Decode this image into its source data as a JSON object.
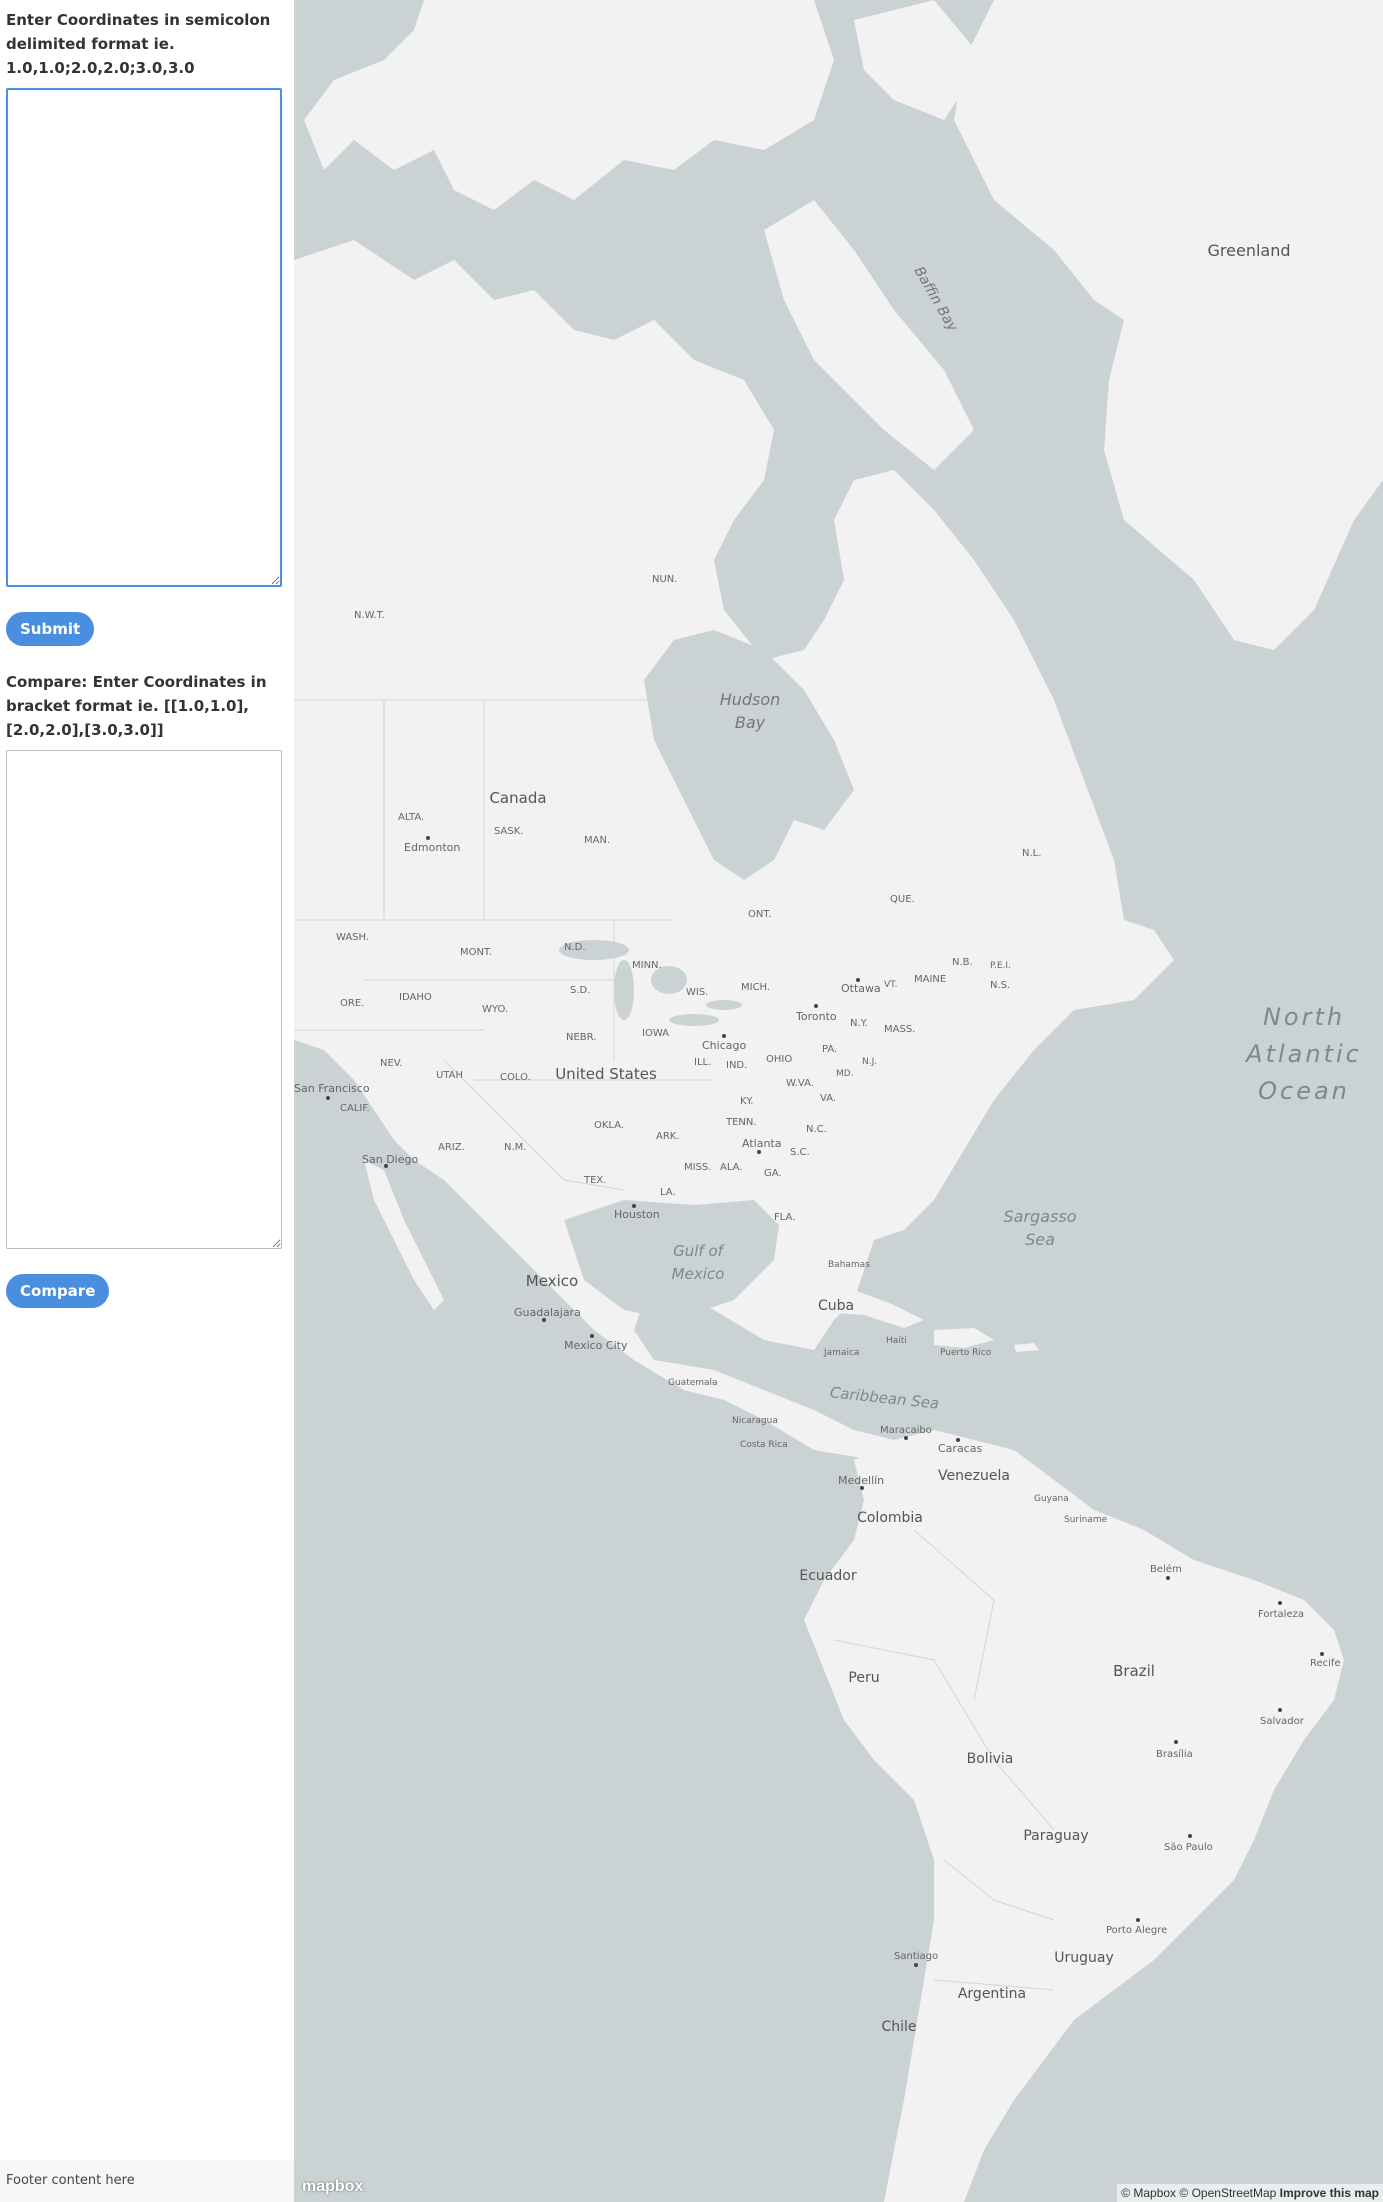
{
  "sidebar": {
    "input_label": "Enter Coordinates in semicolon delimited format ie. 1.0,1.0;2.0,2.0;3.0,3.0",
    "input_value": "",
    "submit_label": "Submit",
    "compare_label_text": "Compare: Enter Coordinates in bracket format ie. [[1.0,1.0],[2.0,2.0],[3.0,3.0]]",
    "compare_value": "",
    "compare_button_label": "Compare",
    "footer_text": "Footer content here"
  },
  "map": {
    "land_color": "#f2f2f2",
    "water_color": "#cad2d3",
    "labels": {
      "greenland": "Greenland",
      "baffin_bay": "Baffin Bay",
      "hudson_bay": "Hudson Bay",
      "canada": "Canada",
      "nwt": "N.W.T.",
      "nun": "NUN.",
      "alta": "ALTA.",
      "sask": "SASK.",
      "man": "MAN.",
      "edmonton": "Edmonton",
      "ont": "ONT.",
      "que": "QUE.",
      "nl": "N.L.",
      "nb": "N.B.",
      "ns": "N.S.",
      "pei": "P.E.I.",
      "ottawa": "Ottawa",
      "toronto": "Toronto",
      "wash": "WASH.",
      "mont": "MONT.",
      "nd": "N.D.",
      "minn": "MINN.",
      "ore": "ORE.",
      "idaho": "IDAHO",
      "wyo": "WYO.",
      "sd": "S.D.",
      "wis": "WIS.",
      "mich": "MICH.",
      "ny": "N.Y.",
      "vt": "VT.",
      "maine": "MAINE",
      "mass": "MASS.",
      "nebr": "NEBR.",
      "iowa": "IOWA",
      "nev": "NEV.",
      "utah": "UTAH",
      "colo": "COLO.",
      "ill": "ILL.",
      "ind": "IND.",
      "ohio": "OHIO",
      "pa": "PA.",
      "md": "MD.",
      "nj": "N.J.",
      "chicago": "Chicago",
      "united_states": "United States",
      "wva": "W.VA.",
      "va": "VA.",
      "ky": "KY.",
      "calif": "CALIF.",
      "san_francisco": "San Francisco",
      "ariz": "ARIZ.",
      "nm": "N.M.",
      "okla": "OKLA.",
      "ark": "ARK.",
      "tenn": "TENN.",
      "nc": "N.C.",
      "sc": "S.C.",
      "atlanta": "Atlanta",
      "san_diego": "San Diego",
      "tex": "TEX.",
      "miss": "MISS.",
      "ala": "ALA.",
      "ga": "GA.",
      "la": "LA.",
      "fla": "FLA.",
      "houston": "Houston",
      "north_atlantic_1": "North",
      "north_atlantic_2": "Atlantic",
      "north_atlantic_3": "Ocean",
      "sargasso_1": "Sargasso",
      "sargasso_2": "Sea",
      "gulf_1": "Gulf of",
      "gulf_2": "Mexico",
      "mexico": "Mexico",
      "bahamas": "Bahamas",
      "cuba": "Cuba",
      "guadalajara": "Guadalajara",
      "mexico_city": "Mexico City",
      "haiti": "Haiti",
      "jamaica": "Jamaica",
      "puerto_rico": "Puerto Rico",
      "guatemala": "Guatemala",
      "caribbean": "Caribbean Sea",
      "nicaragua": "Nicaragua",
      "maracaibo": "Maracaibo",
      "caracas": "Caracas",
      "costa_rica": "Costa Rica",
      "venezuela": "Venezuela",
      "medellin": "Medellín",
      "guyana": "Guyana",
      "suriname": "Suriname",
      "colombia": "Colombia",
      "belem": "Belém",
      "ecuador": "Ecuador",
      "fortaleza": "Fortaleza",
      "recife": "Recife",
      "peru": "Peru",
      "brazil": "Brazil",
      "salvador": "Salvador",
      "bolivia": "Bolivia",
      "brasilia": "Brasília",
      "paraguay": "Paraguay",
      "sao_paulo": "São Paulo",
      "porto_alegre": "Porto Alegre",
      "santiago": "Santiago",
      "uruguay": "Uruguay",
      "argentina": "Argentina",
      "chile": "Chile"
    },
    "attribution": {
      "mapbox": "© Mapbox",
      "osm": "© OpenStreetMap",
      "improve": "Improve this map"
    },
    "logo_text": "mapbox"
  }
}
